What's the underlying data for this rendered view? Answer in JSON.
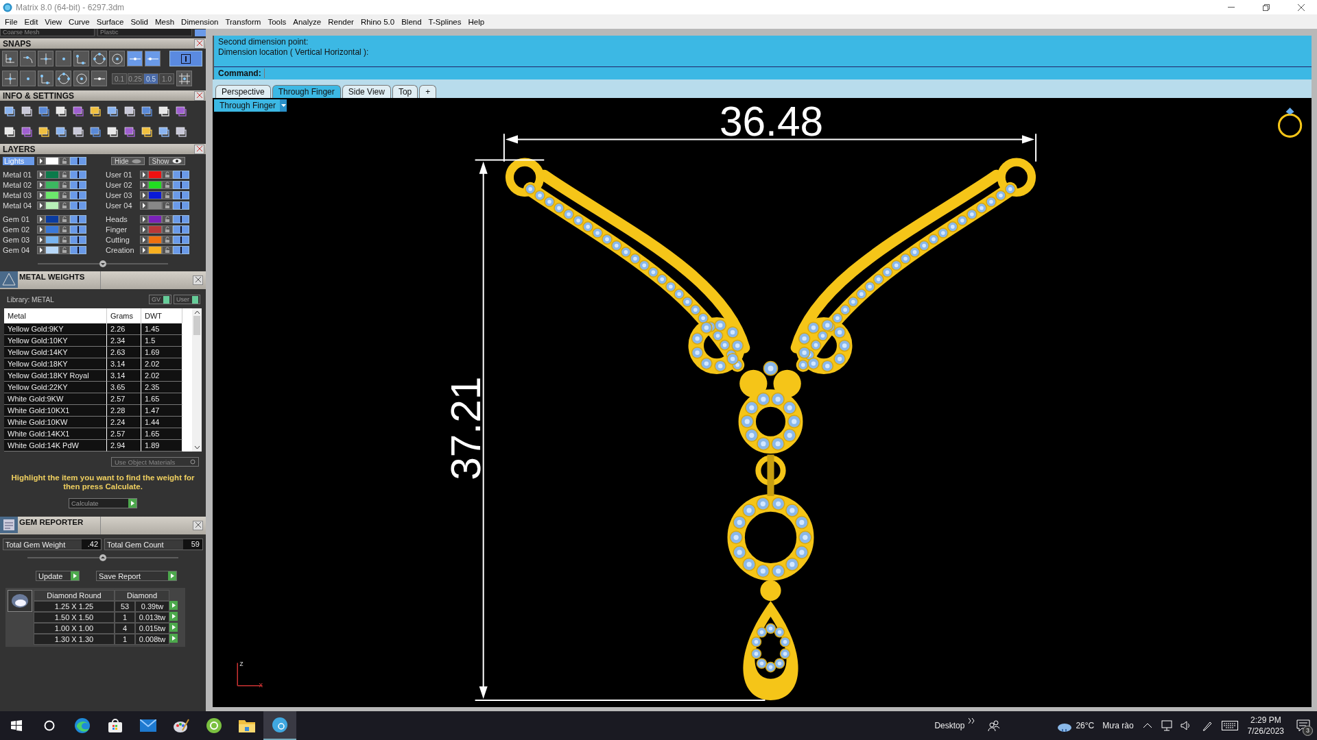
{
  "window": {
    "title": "Matrix 8.0 (64-bit) - 6297.3dm"
  },
  "menu": [
    "File",
    "Edit",
    "View",
    "Curve",
    "Surface",
    "Solid",
    "Mesh",
    "Dimension",
    "Transform",
    "Tools",
    "Analyze",
    "Render",
    "Rhino 5.0",
    "Blend",
    "T-Splines",
    "Help"
  ],
  "top_dropdowns": [
    "Coarse Mesh",
    "Plastic"
  ],
  "snaps": {
    "title": "SNAPS",
    "tools": [
      {
        "on": false
      },
      {
        "on": false
      },
      {
        "on": false
      },
      {
        "on": false
      },
      {
        "on": false
      },
      {
        "on": false
      },
      {
        "on": false
      },
      {
        "on": true
      },
      {
        "on": true
      }
    ],
    "ortho": {
      "on": true
    },
    "increments": [
      {
        "label": "0.1",
        "selected": false
      },
      {
        "label": "0.25",
        "selected": false
      },
      {
        "label": "0.5",
        "selected": true
      },
      {
        "label": "1.0",
        "selected": false
      }
    ]
  },
  "info_settings": {
    "title": "INFO & SETTINGS"
  },
  "layers": {
    "title": "LAYERS",
    "lights": {
      "name": "Lights",
      "color": "#ffffff",
      "visible": true
    },
    "hide": "Hide",
    "show": "Show",
    "left": [
      [
        {
          "name": "Metal 01",
          "color": "#0b7a4a",
          "visible": true
        },
        {
          "name": "Metal 02",
          "color": "#3cb860",
          "visible": true
        },
        {
          "name": "Metal 03",
          "color": "#6ce86c",
          "visible": true
        },
        {
          "name": "Metal 04",
          "color": "#b8f0b8",
          "visible": true
        }
      ],
      [
        {
          "name": "Gem 01",
          "color": "#0b3ca0",
          "visible": true
        },
        {
          "name": "Gem 02",
          "color": "#3a78d8",
          "visible": true
        },
        {
          "name": "Gem 03",
          "color": "#78b4f0",
          "visible": true
        },
        {
          "name": "Gem 04",
          "color": "#b8d8f8",
          "visible": true
        }
      ]
    ],
    "right": [
      [
        {
          "name": "User 01",
          "color": "#ee1111",
          "visible": true
        },
        {
          "name": "User 02",
          "color": "#22dd22",
          "visible": true
        },
        {
          "name": "User 03",
          "color": "#0a1ad8",
          "visible": true
        },
        {
          "name": "User 04",
          "color": "#888888",
          "visible": true
        }
      ],
      [
        {
          "name": "Heads",
          "color": "#7a22b8",
          "visible": true
        },
        {
          "name": "Finger",
          "color": "#b83838",
          "visible": true
        },
        {
          "name": "Cutting",
          "color": "#ee7010",
          "visible": true
        },
        {
          "name": "Creation",
          "color": "#f8b020",
          "visible": true
        }
      ]
    ]
  },
  "metal_weights": {
    "title": "METAL WEIGHTS",
    "library": "Library: METAL",
    "toggles": [
      "GV",
      "User"
    ],
    "columns": [
      "Metal",
      "Grams",
      "DWT"
    ],
    "rows": [
      [
        "Yellow Gold:9KY",
        "2.26",
        "1.45"
      ],
      [
        "Yellow Gold:10KY",
        "2.34",
        "1.5"
      ],
      [
        "Yellow Gold:14KY",
        "2.63",
        "1.69"
      ],
      [
        "Yellow Gold:18KY",
        "3.14",
        "2.02"
      ],
      [
        "Yellow Gold:18KY Royal",
        "3.14",
        "2.02"
      ],
      [
        "Yellow Gold:22KY",
        "3.65",
        "2.35"
      ],
      [
        "White Gold:9KW",
        "2.57",
        "1.65"
      ],
      [
        "White Gold:10KX1",
        "2.28",
        "1.47"
      ],
      [
        "White Gold:10KW",
        "2.24",
        "1.44"
      ],
      [
        "White Gold:14KX1",
        "2.57",
        "1.65"
      ],
      [
        "White Gold:14K PdW",
        "2.94",
        "1.89"
      ]
    ],
    "use_object_materials": "Use Object Materials",
    "hint": "Highlight the item you want to find the weight for then press Calculate.",
    "calculate": "Calculate"
  },
  "gem_reporter": {
    "title": "GEM REPORTER",
    "total_weight_label": "Total Gem Weight",
    "total_weight": ".42",
    "total_count_label": "Total Gem Count",
    "total_count": "59",
    "update": "Update",
    "save_report": "Save Report",
    "columns": [
      "Diamond Round",
      "Diamond"
    ],
    "rows": [
      [
        "1.25 X 1.25",
        "53",
        "0.39tw"
      ],
      [
        "1.50 X 1.50",
        "1",
        "0.013tw"
      ],
      [
        "1.00 X 1.00",
        "4",
        "0.015tw"
      ],
      [
        "1.30 X 1.30",
        "1",
        "0.008tw"
      ]
    ]
  },
  "command": {
    "history": [
      "Second dimension point:",
      "Dimension location ( Vertical  Horizontal ):"
    ],
    "prompt": "Command:"
  },
  "viewport_tabs": [
    {
      "label": "Perspective",
      "selected": false
    },
    {
      "label": "Through Finger",
      "selected": true
    },
    {
      "label": "Side View",
      "selected": false
    },
    {
      "label": "Top",
      "selected": false
    }
  ],
  "add_tab": "+",
  "viewport": {
    "view_name": "Through Finger",
    "width_dimension": "36.48",
    "height_dimension": "37.21",
    "axis_labels": [
      "z",
      "x"
    ]
  },
  "taskbar": {
    "desktop": "Desktop",
    "temperature": "26°C",
    "weather": "Mưa rào",
    "time": "2:29 PM",
    "date": "7/26/2023",
    "notifications": "3"
  }
}
